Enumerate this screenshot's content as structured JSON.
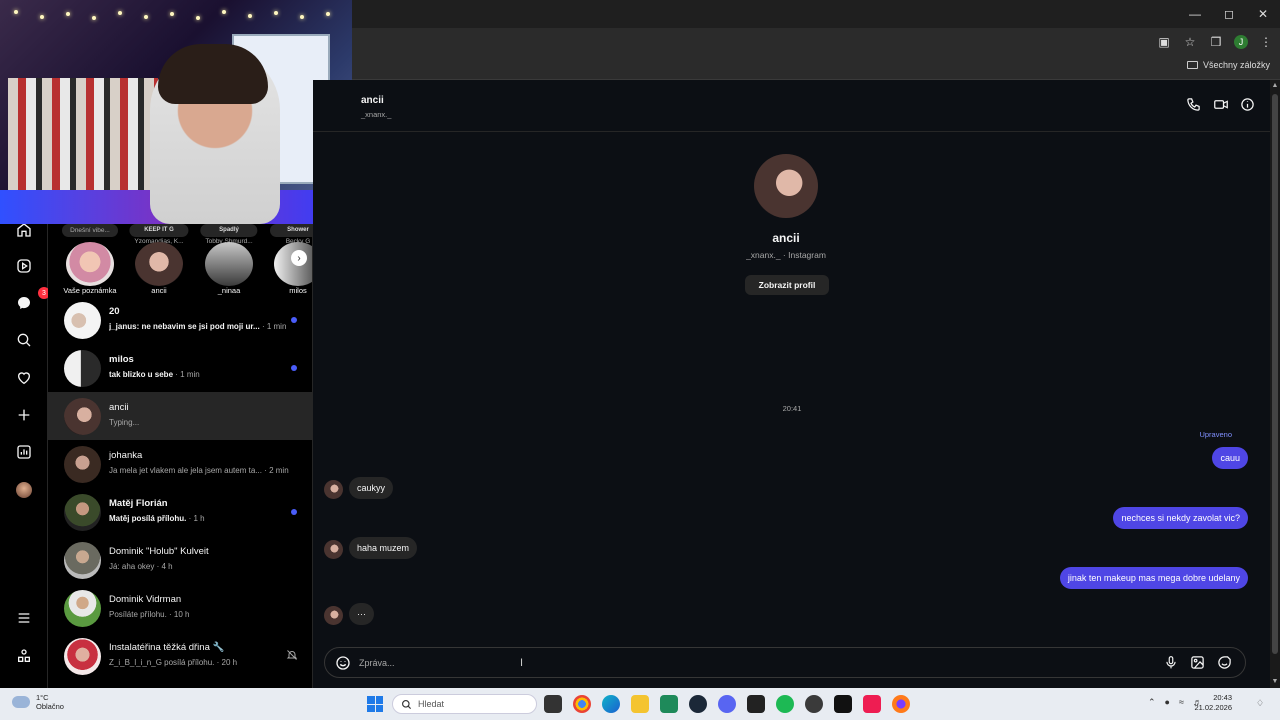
{
  "browser": {
    "bookmarks_all": "Všechny záložky",
    "profile_letter": "J"
  },
  "nav": {
    "badge_count": "3",
    "icons": [
      "home-icon",
      "reels-icon",
      "messenger-icon",
      "search-icon",
      "heart-icon",
      "plus-icon",
      "dashboard-icon",
      "profile-avatar",
      "menu-icon",
      "meta-icon"
    ]
  },
  "notes": [
    {
      "bubble": "Dnešní vibe...",
      "bubble_sub": "",
      "name": "Vaše poznámka"
    },
    {
      "bubble": "Yzomandias, K...",
      "bubble_sub": "KEEP IT G",
      "name": "ancii"
    },
    {
      "bubble": "Tobby Shmurd...",
      "bubble_sub": "Spadlý",
      "name": "_ninaa"
    },
    {
      "bubble": "Becky G",
      "bubble_sub": "Shower",
      "name": "milos"
    }
  ],
  "conversations": [
    {
      "name": "20",
      "message": "j_janus: ne nebavim se jsi pod moji ur...",
      "time": "· 1 min",
      "unread": true,
      "bold": true
    },
    {
      "name": "milos",
      "message": "tak blizko u sebe",
      "time": "· 1 min",
      "unread": true,
      "bold": true
    },
    {
      "name": "ancii",
      "message": "Typing...",
      "time": "",
      "unread": false,
      "bold": false
    },
    {
      "name": "johanka",
      "message": "Ja mela jet vlakem ale jela jsem autem ta...",
      "time": "· 2 min",
      "unread": false,
      "bold": false
    },
    {
      "name": "Matěj Florián",
      "message": "Matěj posílá přílohu.",
      "time": "· 1 h",
      "unread": true,
      "bold": true
    },
    {
      "name": "Dominik \"Holub\" Kulveit",
      "message": "Já: aha okey",
      "time": "· 4 h",
      "unread": false,
      "bold": false
    },
    {
      "name": "Dominik Vidrman",
      "message": "Posíláte přílohu.",
      "time": "· 10 h",
      "unread": false,
      "bold": false
    },
    {
      "name": "Instalatéřina těžká dřina 🔧",
      "message": "Z_i_B_l_i_n_G posílá přílohu.",
      "time": "· 20 h",
      "unread": false,
      "bold": false,
      "muted": true
    }
  ],
  "chat": {
    "header_name": "ancii",
    "header_username": "_xnanx._",
    "profile_name": "ancii",
    "profile_sub": "_xnanx._ · Instagram",
    "profile_button": "Zobrazit profil",
    "timestamp": "20:41",
    "edited_label": "Upraveno",
    "messages": [
      {
        "from": "me",
        "text": "cauu"
      },
      {
        "from": "them",
        "text": "caukyy"
      },
      {
        "from": "me",
        "text": "nechces si nekdy zavolat vic?"
      },
      {
        "from": "them",
        "text": "haha muzem"
      },
      {
        "from": "me",
        "text": "jinak ten makeup mas mega dobre udelany"
      },
      {
        "from": "them",
        "text": "···"
      }
    ],
    "composer_placeholder": "Zpráva..."
  },
  "taskbar": {
    "temperature": "1°C",
    "weather": "Oblačno",
    "search_placeholder": "Hledat",
    "time": "20:43",
    "date": "21.02.2026"
  },
  "colors": {
    "outgoing_bubble": "#4f46e5",
    "incoming_bubble": "#262626",
    "unread_dot": "#4a5df9",
    "badge": "#ff3040",
    "chat_bg": "#0c0f14"
  }
}
